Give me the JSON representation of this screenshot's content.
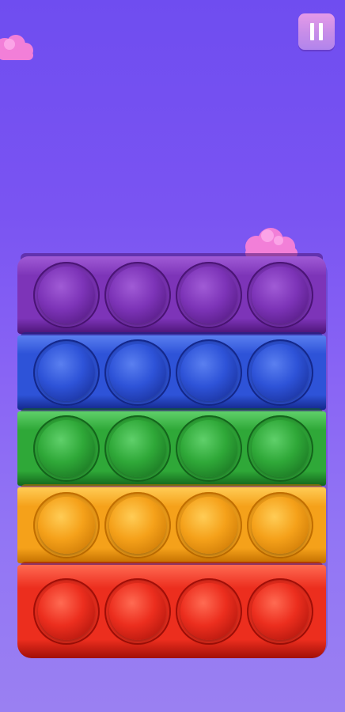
{
  "game": {
    "background_top": "#6f4df0",
    "background_bottom": "#9a80f2"
  },
  "pause_button": {
    "icon": "pause-icon",
    "color": "#c98ee8"
  },
  "decorations": {
    "clouds": [
      "cloud-left",
      "cloud-right"
    ],
    "cloud_color": "#f27fd8"
  },
  "popit": {
    "rows": [
      {
        "name": "purple",
        "color": "#7d34b8",
        "bubble_light": "#a05bd6",
        "bubble_dark": "#4b1476",
        "popped": [
          false,
          false,
          false,
          false
        ]
      },
      {
        "name": "blue",
        "color": "#2e53d8",
        "bubble_light": "#5a7ff0",
        "bubble_dark": "#14288c",
        "popped": [
          false,
          false,
          false,
          false
        ]
      },
      {
        "name": "green",
        "color": "#2fa838",
        "bubble_light": "#5fd06a",
        "bubble_dark": "#14661c",
        "popped": [
          false,
          false,
          false,
          false
        ]
      },
      {
        "name": "orange",
        "color": "#f5a11a",
        "bubble_light": "#ffcc55",
        "bubble_dark": "#c26f00",
        "popped": [
          false,
          false,
          false,
          false
        ]
      },
      {
        "name": "red",
        "color": "#ec2e1e",
        "bubble_light": "#ff6a52",
        "bubble_dark": "#a10f08",
        "popped": [
          false,
          false,
          false,
          false
        ]
      }
    ]
  }
}
